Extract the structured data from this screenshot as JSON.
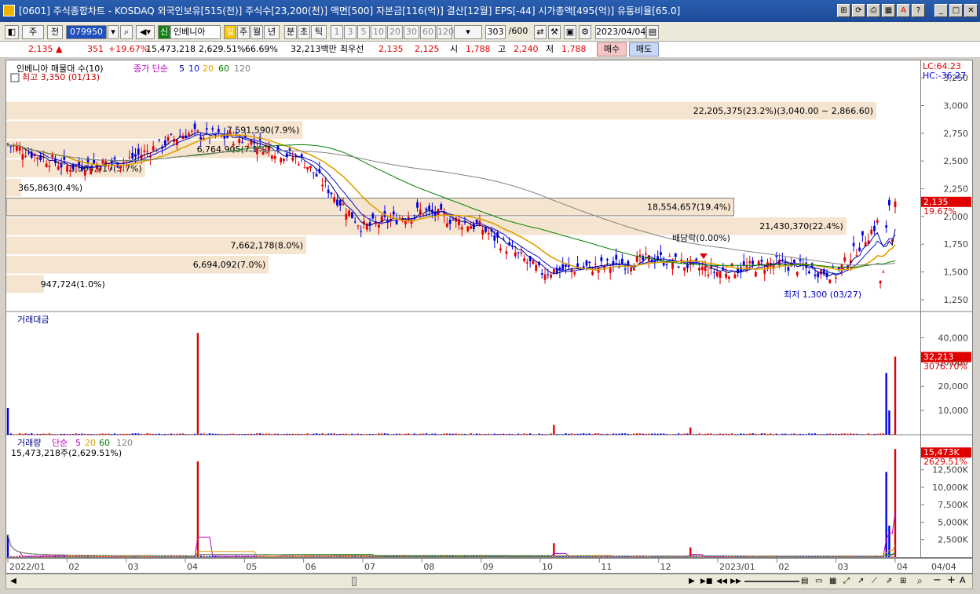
{
  "window": {
    "title": "[0601] 주식종합차트 - KOSDAQ 외국인보유[515(천)] 주식수[23,200(천)] 액면[500] 자본금[116(억)] 결산[12월] EPS[-44] 시가총액[495(억)] 유통비율[65.0]"
  },
  "toolbar": {
    "market": "주",
    "prev": "전",
    "code": "079950",
    "badge": "신",
    "name": "인베니아",
    "periods": [
      "일",
      "주",
      "월",
      "년",
      "분",
      "초",
      "틱"
    ],
    "ticks": [
      "1",
      "3",
      "5",
      "10",
      "20",
      "30",
      "60",
      "120"
    ],
    "count": "303",
    "count_max": "/600",
    "date": "2023/04/04"
  },
  "quote": {
    "price": "2,135",
    "arrow": "▲",
    "change": "351",
    "rate": "+19.67%",
    "volume": "15,473,218",
    "volume_rate": "2,629.51%",
    "turnover": "66.69%",
    "amount": "32,213백만",
    "best_label": "최우선",
    "ask": "2,135",
    "bid": "2,125",
    "open_label": "시",
    "open": "1,788",
    "high_label": "고",
    "high": "2,240",
    "low_label": "저",
    "low": "1,788",
    "buy": "매수",
    "sell": "매도"
  },
  "price_panel": {
    "legend_name": "인베니아 매물대 수(10)",
    "ma_label": "종가 단순",
    "ma_periods": [
      "5",
      "10",
      "20",
      "60",
      "120"
    ],
    "ma_colors": [
      "#000080",
      "#1010d0",
      "#e0a000",
      "#008000",
      "#808080"
    ],
    "high_note": "최고 3,350 (01/13)",
    "low_note": "최저 1,300 (03/27)",
    "dividend": "배당락(0.00%)",
    "lc": "LC:64.23",
    "hc": "HC:-36.27",
    "last_price": "2,135",
    "last_rate": "19.67%",
    "y_ticks": [
      "3,250",
      "3,000",
      "2,750",
      "2,500",
      "2,250",
      "2,000",
      "1,750",
      "1,500",
      "1,250"
    ],
    "vol_profile": [
      {
        "label": "22,205,375(23.2%)(3,040.00 ~ 2,866.60)",
        "pct": 23.2,
        "lo": 2866.6,
        "hi": 3040
      },
      {
        "label": "7,591,590(7.9%)",
        "pct": 7.9,
        "lo": 2693.2,
        "hi": 2866.6
      },
      {
        "label": "6,764,905(7.1%)",
        "pct": 7.1,
        "lo": 2519.8,
        "hi": 2693.2
      },
      {
        "label": "3,504,917(3.7%)",
        "pct": 3.7,
        "lo": 2346.4,
        "hi": 2519.8
      },
      {
        "label": "365,863(0.4%)",
        "pct": 0.4,
        "lo": 2173.0,
        "hi": 2346.4
      },
      {
        "label": "18,554,657(19.4%)",
        "pct": 19.4,
        "lo": 1999.6,
        "hi": 2173.0
      },
      {
        "label": "21,430,370(22.4%)",
        "pct": 22.4,
        "lo": 1826.2,
        "hi": 1999.6
      },
      {
        "label": "7,662,178(8.0%)",
        "pct": 8.0,
        "lo": 1652.8,
        "hi": 1826.2
      },
      {
        "label": "6,694,092(7.0%)",
        "pct": 7.0,
        "lo": 1479.4,
        "hi": 1652.8
      },
      {
        "label": "947,724(1.0%)",
        "pct": 1.0,
        "lo": 1306.0,
        "hi": 1479.4
      }
    ]
  },
  "amount_panel": {
    "title": "거래대금",
    "last": "32,213",
    "last_rate": "3076.70%",
    "y_ticks": [
      "40,000",
      "30,000",
      "20,000",
      "10,000"
    ]
  },
  "volume_panel": {
    "title": "거래량",
    "ma_label": "단순",
    "ma_periods": [
      "5",
      "20",
      "60",
      "120"
    ],
    "ma_colors": [
      "#c000c0",
      "#e0a000",
      "#008000",
      "#808080"
    ],
    "info": "15,473,218주(2,629.51%)",
    "last": "15,473K",
    "last_rate": "2629.51%",
    "y_ticks": [
      "12,500K",
      "10,000K",
      "7,500K",
      "5,000K",
      "2,500K"
    ]
  },
  "x_axis": {
    "labels": [
      "2022/01",
      "02",
      "03",
      "04",
      "05",
      "06",
      "07",
      "08",
      "09",
      "10",
      "11",
      "12",
      "2023/01",
      "02",
      "03",
      "04"
    ],
    "right_label": "04/04"
  },
  "chart_data": {
    "type": "candlestick",
    "x": [
      "2022-01",
      "2022-02",
      "2022-03",
      "2022-04",
      "2022-05",
      "2022-06",
      "2022-07",
      "2022-08",
      "2022-09",
      "2022-10",
      "2022-11",
      "2022-12",
      "2023-01",
      "2023-02",
      "2023-03",
      "2023-04"
    ],
    "close": [
      2650,
      2450,
      2500,
      2750,
      2700,
      2500,
      1900,
      2050,
      1900,
      1500,
      1550,
      1620,
      1500,
      1580,
      1480,
      2135
    ],
    "ylim": [
      1200,
      3350
    ],
    "amount_ylim": [
      0,
      45000
    ],
    "volume_ylim": [
      0,
      15500
    ]
  }
}
